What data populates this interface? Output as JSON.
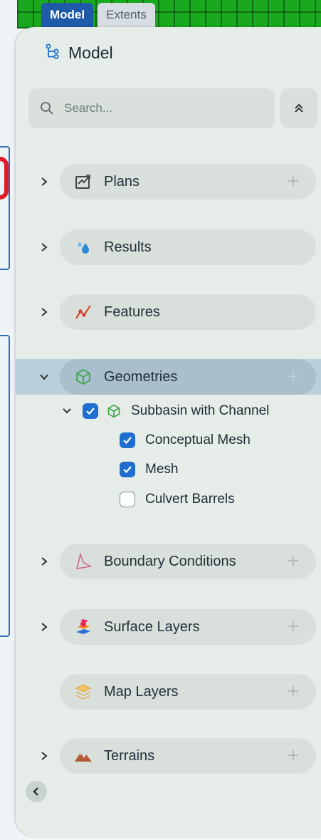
{
  "tabs": [
    {
      "label": "Model",
      "active": true
    },
    {
      "label": "Extents",
      "active": false
    }
  ],
  "panel": {
    "title": "Model",
    "icon": "tree-structure-icon"
  },
  "search": {
    "placeholder": "Search...",
    "value": ""
  },
  "sections": [
    {
      "id": "plans",
      "label": "Plans",
      "icon": "plans-icon",
      "has_add": true,
      "expandable": true
    },
    {
      "id": "results",
      "label": "Results",
      "icon": "droplets-icon",
      "has_add": false,
      "expandable": true
    },
    {
      "id": "features",
      "label": "Features",
      "icon": "polyline-icon",
      "has_add": false,
      "expandable": true
    },
    {
      "id": "geometries",
      "label": "Geometries",
      "icon": "cube-icon",
      "has_add": true,
      "expandable": true,
      "expanded": true,
      "selected": true
    },
    {
      "id": "boundary",
      "label": "Boundary Conditions",
      "icon": "boundary-icon",
      "has_add": true,
      "expandable": true
    },
    {
      "id": "surface",
      "label": "Surface Layers",
      "icon": "surface-layers-icon",
      "has_add": true,
      "expandable": true
    },
    {
      "id": "map",
      "label": "Map Layers",
      "icon": "layers-icon",
      "has_add": true,
      "expandable": false
    },
    {
      "id": "terrains",
      "label": "Terrains",
      "icon": "mountains-icon",
      "has_add": true,
      "expandable": true
    }
  ],
  "geometry_tree": {
    "parent": {
      "label": "Subbasin with Channel",
      "checked": true,
      "expanded": true
    },
    "children": [
      {
        "label": "Conceptual Mesh",
        "checked": true
      },
      {
        "label": "Mesh",
        "checked": true
      },
      {
        "label": "Culvert Barrels",
        "checked": false
      }
    ]
  },
  "colors": {
    "accent": "#1e6fd0",
    "tab_active": "#1e5aa8",
    "panel_bg": "#e6ede8",
    "selected_row": "#b9cfd9"
  }
}
